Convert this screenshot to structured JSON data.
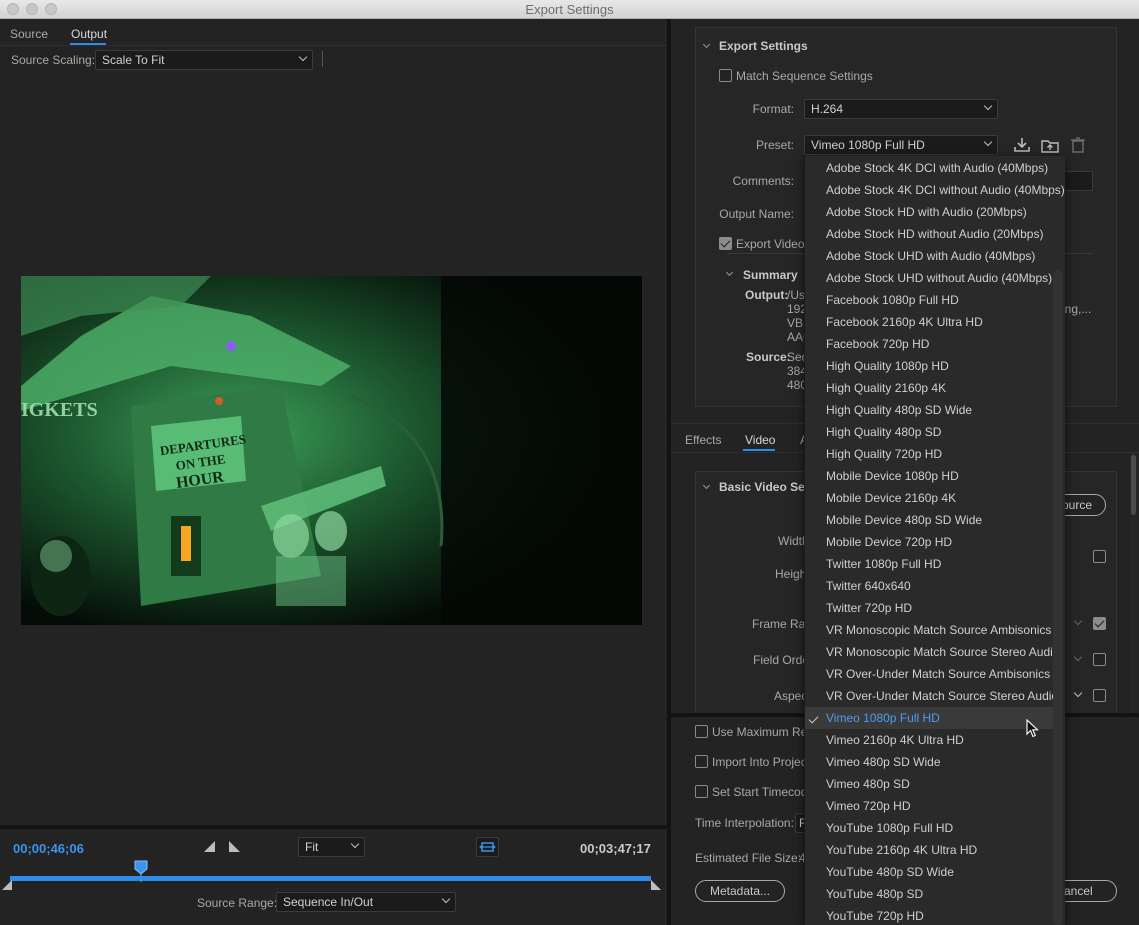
{
  "window": {
    "title": "Export Settings"
  },
  "left_panel": {
    "tabs": [
      {
        "label": "Source"
      },
      {
        "label": "Output"
      }
    ],
    "source_scaling": {
      "label": "Source Scaling:",
      "value": "Scale To Fit"
    },
    "current_timecode": "00;00;46;06",
    "fit": {
      "value": "Fit"
    },
    "end_timecode": "00;03;47;17",
    "source_range": {
      "label": "Source Range:",
      "value": "Sequence In/Out"
    }
  },
  "export_settings": {
    "section_title": "Export Settings",
    "match_sequence": {
      "label": "Match Sequence Settings",
      "checked": false
    },
    "format": {
      "label": "Format:",
      "value": "H.264"
    },
    "preset": {
      "label": "Preset:",
      "value": "Vimeo 1080p Full HD"
    },
    "comments": {
      "label": "Comments:"
    },
    "output_name": {
      "label": "Output Name:"
    },
    "export_video": {
      "label": "Export Video",
      "checked": true
    },
    "summary": {
      "title": "Summary",
      "output_label": "Output:",
      "output_lines": [
        "/Us",
        "192",
        "VBF",
        "AAC"
      ],
      "output_trailing": "ing,...",
      "source_label": "Source:",
      "source_lines": [
        "Seq",
        "384",
        "480"
      ]
    }
  },
  "lower_tabs": [
    {
      "label": "Effects"
    },
    {
      "label": "Video"
    },
    {
      "label": "A"
    }
  ],
  "basic_video": {
    "section_title": "Basic Video Setti",
    "match_source_button": "ource",
    "labels": [
      "Widtl",
      "Heigh",
      "Frame Rat",
      "Field Orde",
      "Aspec"
    ]
  },
  "bottom_options": {
    "use_max_render": "Use Maximum Ren",
    "import_into_project": "Import Into Project",
    "set_start_timecode": "Set Start Timecode",
    "time_interpolation": {
      "label": "Time Interpolation:",
      "value": "F"
    },
    "estimated_file_size": {
      "label": "Estimated File Size:",
      "value": "4"
    },
    "metadata_button": "Metadata...",
    "cancel_button": "ancel"
  },
  "preset_menu": {
    "selected": "Vimeo 1080p Full HD",
    "items": [
      "Adobe Stock 4K DCI with Audio (40Mbps)",
      "Adobe Stock 4K DCI without Audio (40Mbps)",
      "Adobe Stock HD with Audio (20Mbps)",
      "Adobe Stock HD without Audio (20Mbps)",
      "Adobe Stock UHD with Audio (40Mbps)",
      "Adobe Stock UHD without Audio (40Mbps)",
      "Facebook 1080p Full HD",
      "Facebook 2160p 4K Ultra HD",
      "Facebook 720p HD",
      "High Quality 1080p HD",
      "High Quality 2160p 4K",
      "High Quality 480p SD Wide",
      "High Quality 480p SD",
      "High Quality 720p HD",
      "Mobile Device 1080p HD",
      "Mobile Device 2160p 4K",
      "Mobile Device 480p SD Wide",
      "Mobile Device 720p HD",
      "Twitter 1080p Full HD",
      "Twitter 640x640",
      "Twitter 720p HD",
      "VR Monoscopic Match Source Ambisonics",
      "VR Monoscopic Match Source Stereo Audio",
      "VR Over-Under Match Source Ambisonics",
      "VR Over-Under Match Source Stereo Audio",
      "Vimeo 1080p Full HD",
      "Vimeo 2160p 4K Ultra HD",
      "Vimeo 480p SD Wide",
      "Vimeo 480p SD",
      "Vimeo 720p HD",
      "YouTube 1080p Full HD",
      "YouTube 2160p 4K Ultra HD",
      "YouTube 480p SD Wide",
      "YouTube 480p SD",
      "YouTube 720p HD"
    ]
  },
  "colors": {
    "accent": "#2d8ceb",
    "selected_text": "#4b9df0"
  },
  "icons": [
    "save-preset-icon",
    "import-preset-icon",
    "delete-preset-icon",
    "playhead-icon",
    "mark-in-icon",
    "mark-out-icon",
    "crop-icon",
    "checkmark-icon",
    "mouse-cursor-icon"
  ]
}
